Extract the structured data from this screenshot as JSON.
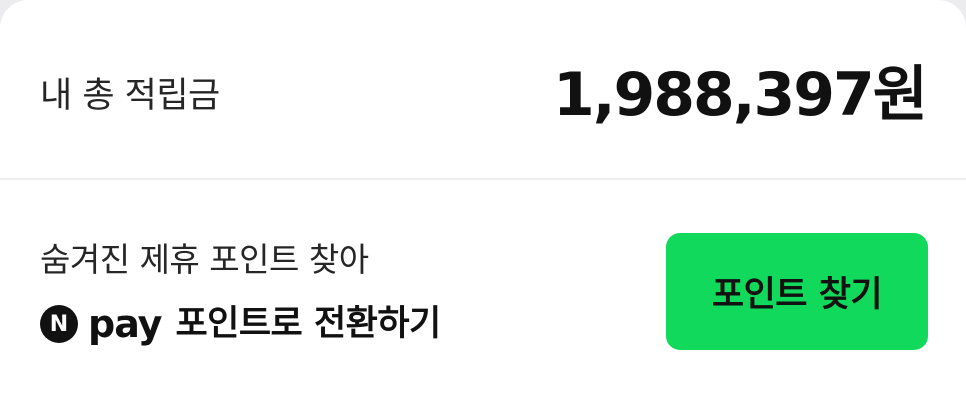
{
  "total": {
    "label": "내 총 적립금",
    "amount": "1,988,397원"
  },
  "find_points": {
    "title": "숨겨진 제휴 포인트 찾아",
    "npay_icon_letter": "N",
    "npay_brand": "pay",
    "npay_description": "포인트로 전환하기",
    "button_label": "포인트 찾기",
    "button_color": "#10d95b"
  }
}
